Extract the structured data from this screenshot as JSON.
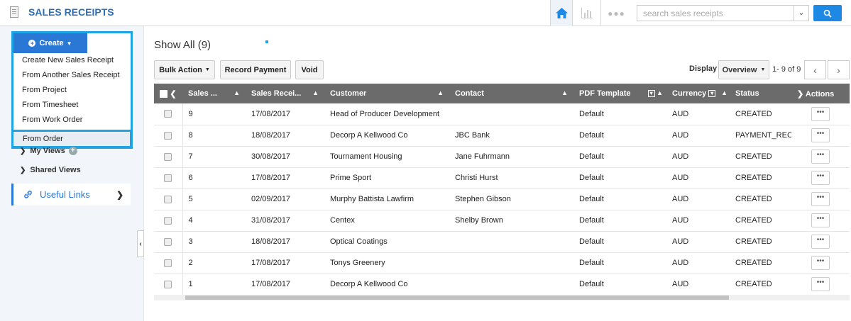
{
  "header": {
    "title": "SALES RECEIPTS",
    "search_placeholder": "search sales receipts"
  },
  "sidebar": {
    "create_label": "Create",
    "create_menu": [
      "Create New Sales Receipt",
      "From Another Sales Receipt",
      "From Project",
      "From Timesheet",
      "From Work Order",
      "From Order"
    ],
    "my_views": "My Views",
    "shared_views": "Shared Views",
    "useful_links": "Useful Links"
  },
  "main": {
    "title": "Show All (9)",
    "toolbar": {
      "bulk_action": "Bulk Action",
      "record_payment": "Record Payment",
      "void": "Void",
      "display_label": "Display",
      "display_value": "Overview",
      "range": "1- 9 of 9"
    },
    "table": {
      "headers": [
        "Sales ...",
        "Sales Recei...",
        "Customer",
        "Contact",
        "PDF Template",
        "Currency",
        "Status",
        "Actions"
      ],
      "rows": [
        [
          "9",
          "17/08/2017",
          "Head of Producer Development",
          "",
          "Default",
          "AUD",
          "CREATED"
        ],
        [
          "8",
          "18/08/2017",
          "Decorp A Kellwood Co",
          "JBC Bank",
          "Default",
          "AUD",
          "PAYMENT_RECE"
        ],
        [
          "7",
          "30/08/2017",
          "Tournament Housing",
          "Jane Fuhrmann",
          "Default",
          "AUD",
          "CREATED"
        ],
        [
          "6",
          "17/08/2017",
          "Prime Sport",
          "Christi Hurst",
          "Default",
          "AUD",
          "CREATED"
        ],
        [
          "5",
          "02/09/2017",
          "Murphy Battista Lawfirm",
          "Stephen Gibson",
          "Default",
          "AUD",
          "CREATED"
        ],
        [
          "4",
          "31/08/2017",
          "Centex",
          "Shelby Brown",
          "Default",
          "AUD",
          "CREATED"
        ],
        [
          "3",
          "18/08/2017",
          "Optical Coatings",
          "",
          "Default",
          "AUD",
          "CREATED"
        ],
        [
          "2",
          "17/08/2017",
          "Tonys Greenery",
          "",
          "Default",
          "AUD",
          "CREATED"
        ],
        [
          "1",
          "17/08/2017",
          "Decorp A Kellwood Co",
          "",
          "Default",
          "AUD",
          "CREATED"
        ]
      ]
    }
  },
  "icons": {
    "home": "home-icon",
    "chart": "chart-icon",
    "more": "more-icon",
    "search": "search-icon",
    "link": "link-icon"
  },
  "colors": {
    "accent": "#2a78d6",
    "highlight": "#1ea3e5",
    "header_bg": "#6b6b6b"
  }
}
